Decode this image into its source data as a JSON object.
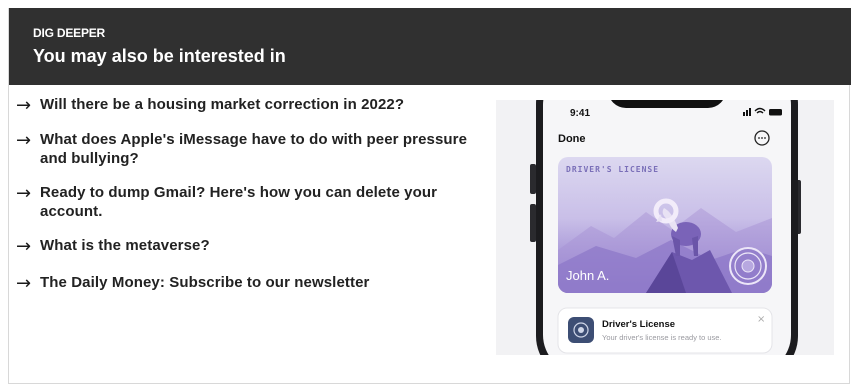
{
  "header": {
    "eyebrow": "DIG DEEPER",
    "title": "You may also be interested in"
  },
  "links": [
    {
      "arrow": "→",
      "text": "Will there be a housing market correction in 2022?"
    },
    {
      "arrow": "→",
      "text": "What does Apple's iMessage have to do with peer pressure and bullying?"
    },
    {
      "arrow": "→",
      "text": "Ready to dump Gmail? Here's how you can delete your account."
    },
    {
      "arrow": "→",
      "text": "What is the metaverse?"
    },
    {
      "arrow": "→",
      "text": "The Daily Money: Subscribe to our newsletter"
    }
  ],
  "phone": {
    "time": "9:41",
    "done_label": "Done",
    "card_label": "DRIVER'S LICENSE",
    "card_name": "John A.",
    "notification_title": "Driver's License",
    "notification_body": "Your driver's license is ready to use.",
    "close_glyph": "×"
  },
  "colors": {
    "header_bg": "#303030",
    "card_top": "#d9d4ef",
    "card_bottom": "#8a72c7",
    "card_label": "#7a6fb8"
  }
}
